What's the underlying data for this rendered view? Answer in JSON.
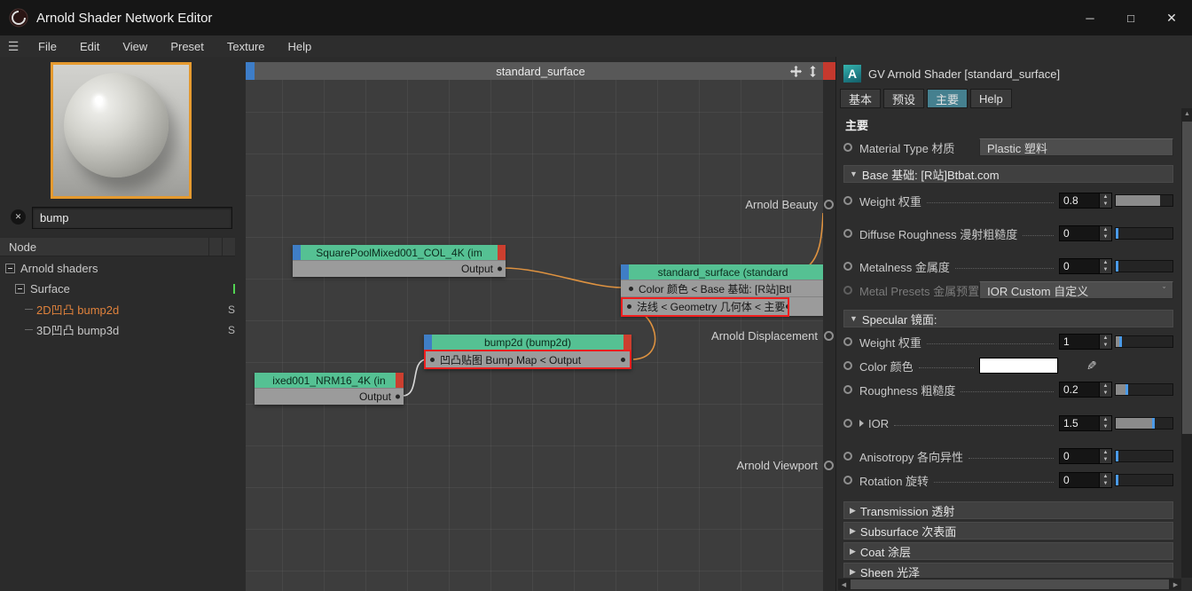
{
  "icons": {
    "hamburger": "☰",
    "minimize": "─",
    "maximize": "□",
    "close": "✕",
    "clear": "✕",
    "spin_up": "▲",
    "spin_down": "▼",
    "section_open": "▼",
    "section_closed": "▶",
    "dropdown": "ˇ",
    "eyedropper": "✎",
    "scroll_up": "▲",
    "scroll_left": "◀",
    "scroll_right": "▶"
  },
  "titlebar": {
    "title": "Arnold Shader Network Editor"
  },
  "menu": {
    "items": [
      "File",
      "Edit",
      "View",
      "Preset",
      "Texture",
      "Help"
    ]
  },
  "left_panel": {
    "search": {
      "value": "bump"
    },
    "tree_header": "Node",
    "tree": [
      {
        "label": "Arnold shaders",
        "badge": ""
      },
      {
        "label": "Surface",
        "badge": ""
      },
      {
        "label": "2D凹凸 bump2d",
        "badge": "S"
      },
      {
        "label": "3D凹凸 bump3d",
        "badge": "S"
      }
    ]
  },
  "graph": {
    "title": "standard_surface",
    "nodes": {
      "tex_col": {
        "title": "SquarePoolMixed001_COL_4K (im",
        "row": "Output"
      },
      "surface": {
        "title": "standard_surface (standard",
        "row_color": "Color 颜色 < Base 基础:  [R站]Btl",
        "row_normal": "法线 < Geometry 几何体 < 主要"
      },
      "bump": {
        "title": "bump2d (bump2d)",
        "row": "凹凸贴图 Bump Map <  Output"
      },
      "tex_nrm": {
        "title": "ixed001_NRM16_4K (in",
        "row": "Output"
      }
    },
    "outputs": [
      {
        "label": "Arnold Beauty"
      },
      {
        "label": "Arnold Displacement"
      },
      {
        "label": "Arnold Viewport"
      }
    ]
  },
  "inspector": {
    "logo_letter": "A",
    "title": "GV Arnold Shader [standard_surface]",
    "tabs": [
      {
        "label": "基本"
      },
      {
        "label": "预设"
      },
      {
        "label": "主要"
      },
      {
        "label": "Help"
      }
    ],
    "heading": "主要",
    "material_type": {
      "label": "Material Type 材质",
      "value": "Plastic 塑料"
    },
    "base_section": "Base 基础:  [R站]Btbat.com",
    "spec_section": "Specular 镜面:",
    "rows": {
      "weight": {
        "label": "Weight 权重",
        "value": "0.8"
      },
      "diffuse_roughness": {
        "label": "Diffuse Roughness 漫射粗糙度",
        "value": "0"
      },
      "metalness": {
        "label": "Metalness 金属度",
        "value": "0"
      },
      "metal_presets": {
        "label": "Metal Presets 金属预置",
        "value": "IOR Custom 自定义"
      },
      "spec_weight": {
        "label": "Weight 权重",
        "value": "1"
      },
      "color": {
        "label": "Color 颜色"
      },
      "roughness": {
        "label": "Roughness 粗糙度",
        "value": "0.2"
      },
      "ior": {
        "label": "IOR",
        "value": "1.5"
      },
      "anisotropy": {
        "label": "Anisotropy 各向异性",
        "value": "0"
      },
      "rotation": {
        "label": "Rotation 旋转",
        "value": "0"
      }
    },
    "collapsed": [
      {
        "label": "Transmission 透射"
      },
      {
        "label": "Subsurface 次表面"
      },
      {
        "label": "Coat 涂层"
      },
      {
        "label": "Sheen 光泽"
      }
    ]
  }
}
